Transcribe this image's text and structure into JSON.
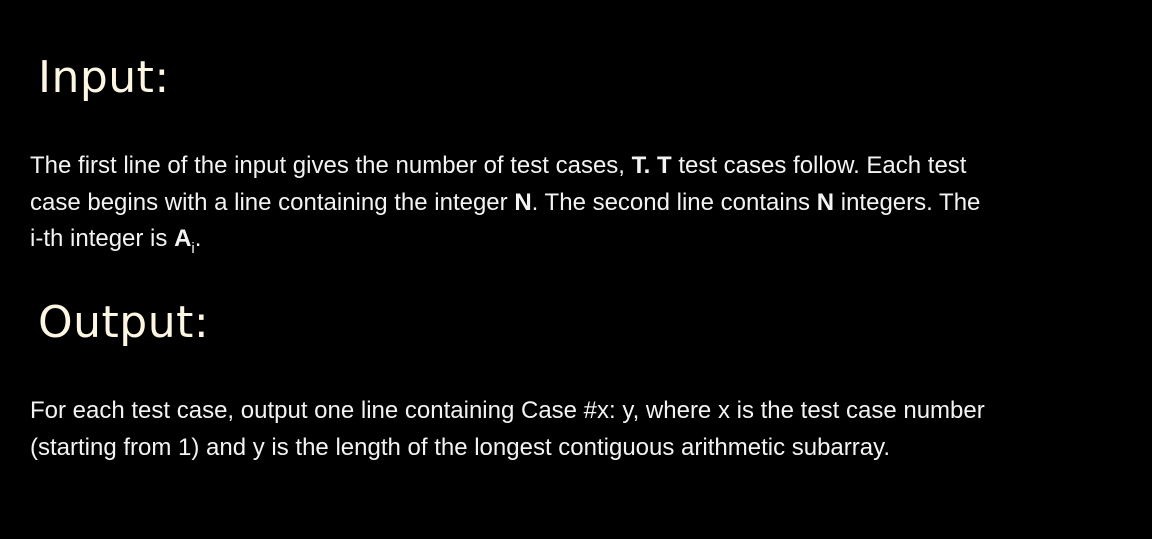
{
  "input": {
    "heading": "Input:",
    "line1_a": "The first line of the input gives the number of test cases, ",
    "line1_t1": "T",
    "line1_b": ". ",
    "line1_t2": "T",
    "line1_c": " test cases follow. Each test",
    "line2_a": "case begins with a line containing the integer ",
    "line2_n1": "N",
    "line2_b": ". The second line contains ",
    "line2_n2": "N",
    "line2_c": " integers. The",
    "line3_a": "i-th integer is ",
    "line3_var": "A",
    "line3_sub": "i",
    "line3_end": "."
  },
  "output": {
    "heading": "Output:",
    "line1": "For each test case, output one line containing Case #x: y, where x is the test case number",
    "line2": "(starting from 1) and y is the length of the longest contiguous arithmetic subarray."
  }
}
